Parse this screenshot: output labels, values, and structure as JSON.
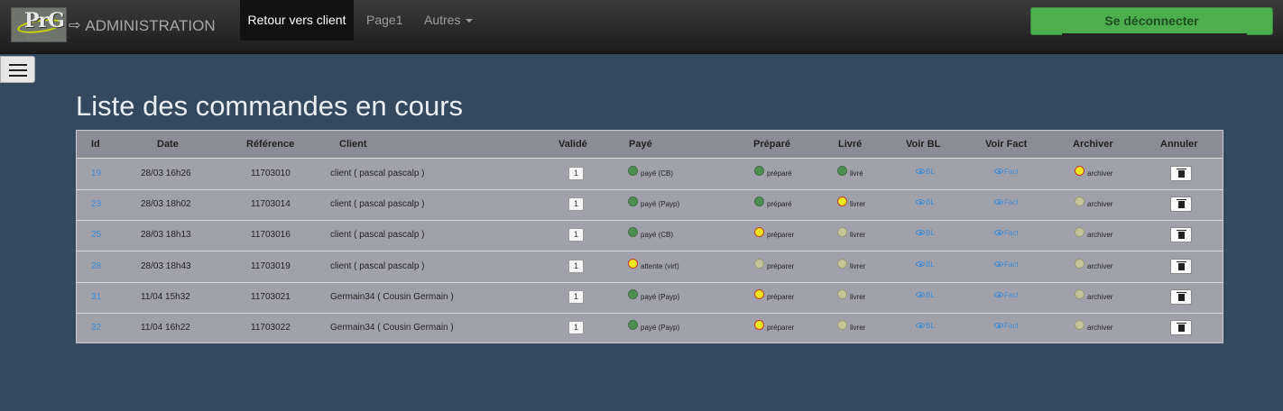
{
  "navbar": {
    "logo_text": "PrG",
    "arrow": "⇨",
    "title": "ADMINISTRATION",
    "items": [
      {
        "label": "Retour vers client",
        "active": true
      },
      {
        "label": "Page1",
        "active": false
      },
      {
        "label": "Autres",
        "active": false
      }
    ],
    "logout_label": "Se déconnecter"
  },
  "page_title": "Liste des commandes en cours",
  "table": {
    "headers": {
      "id": "Id",
      "date": "Date",
      "reference": "Référence",
      "client": "Client",
      "valide": "Validé",
      "paye": "Payé",
      "prepare": "Préparé",
      "livre": "Livré",
      "voir_bl": "Voir BL",
      "voir_fact": "Voir Fact",
      "archiver": "Archiver",
      "annuler": "Annuler"
    },
    "rows": [
      {
        "id": "19",
        "date": "28/03 16h26",
        "ref": "11703010",
        "client": "client ( pascal pascalp )",
        "qty": "1",
        "paye": {
          "state": "green",
          "label": "payé (CB)"
        },
        "prepare": {
          "state": "green",
          "label": "préparé"
        },
        "livre": {
          "state": "green",
          "label": "livré"
        },
        "bl": "BL",
        "fact": "Fact",
        "archiver": {
          "state": "yellow",
          "label": "archiver"
        }
      },
      {
        "id": "23",
        "date": "28/03 18h02",
        "ref": "11703014",
        "client": "client ( pascal pascalp )",
        "qty": "1",
        "paye": {
          "state": "green",
          "label": "payé (Payp)"
        },
        "prepare": {
          "state": "green",
          "label": "préparé"
        },
        "livre": {
          "state": "yellow",
          "label": "livrer"
        },
        "bl": "BL",
        "fact": "Fact",
        "archiver": {
          "state": "grey",
          "label": "archiver"
        }
      },
      {
        "id": "25",
        "date": "28/03 18h13",
        "ref": "11703016",
        "client": "client ( pascal pascalp )",
        "qty": "1",
        "paye": {
          "state": "green",
          "label": "payé (CB)"
        },
        "prepare": {
          "state": "yellow",
          "label": "préparer"
        },
        "livre": {
          "state": "grey",
          "label": "livrer"
        },
        "bl": "BL",
        "fact": "Fact",
        "archiver": {
          "state": "grey",
          "label": "archiver"
        }
      },
      {
        "id": "28",
        "date": "28/03 18h43",
        "ref": "11703019",
        "client": "client ( pascal pascalp )",
        "qty": "1",
        "paye": {
          "state": "yellow",
          "label": "attente (virt)"
        },
        "prepare": {
          "state": "grey",
          "label": "préparer"
        },
        "livre": {
          "state": "grey",
          "label": "livrer"
        },
        "bl": "BL",
        "fact": "Fact",
        "archiver": {
          "state": "grey",
          "label": "archiver"
        }
      },
      {
        "id": "31",
        "date": "11/04 15h32",
        "ref": "11703021",
        "client": "Germain34 ( Cousin Germain )",
        "qty": "1",
        "paye": {
          "state": "green",
          "label": "payé (Payp)"
        },
        "prepare": {
          "state": "yellow",
          "label": "préparer"
        },
        "livre": {
          "state": "grey",
          "label": "livrer"
        },
        "bl": "BL",
        "fact": "Fact",
        "archiver": {
          "state": "grey",
          "label": "archiver"
        }
      },
      {
        "id": "32",
        "date": "11/04 16h22",
        "ref": "11703022",
        "client": "Germain34 ( Cousin Germain )",
        "qty": "1",
        "paye": {
          "state": "green",
          "label": "payé (Payp)"
        },
        "prepare": {
          "state": "yellow",
          "label": "préparer"
        },
        "livre": {
          "state": "grey",
          "label": "livrer"
        },
        "bl": "BL",
        "fact": "Fact",
        "archiver": {
          "state": "grey",
          "label": "archiver"
        }
      }
    ]
  },
  "colors": {
    "background": "#34495e",
    "navbar": "#222222",
    "logout_button": "#4cae4c",
    "link": "#3a8bd4",
    "status_green": "#4f8e52",
    "status_yellow": "#f0e81d",
    "status_grey": "#c3c497"
  },
  "icons": [
    "menu-icon",
    "eye-icon",
    "trash-icon",
    "status-dot-icon",
    "caret-down-icon",
    "arrow-right-icon"
  ]
}
